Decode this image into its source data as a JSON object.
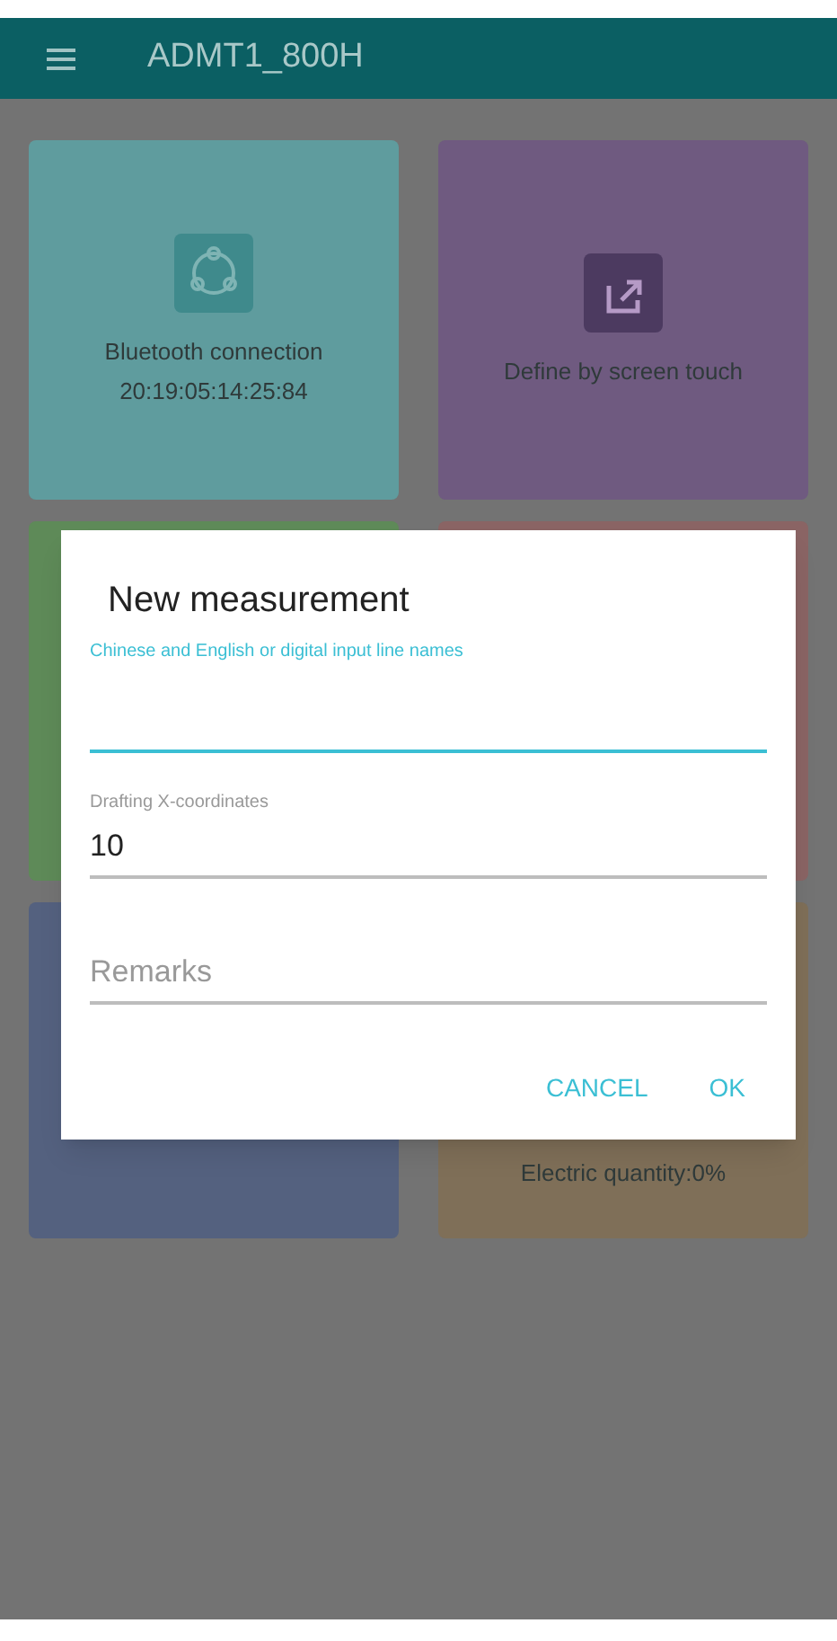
{
  "app_bar": {
    "title": "ADMT1_800H"
  },
  "cards": [
    {
      "kind": "bluetooth",
      "color": "#5f9c9e",
      "lines": [
        "Bluetooth connection",
        "20:19:05:14:25:84"
      ]
    },
    {
      "kind": "touch",
      "color": "#6f5a80",
      "lines": [
        "Define by screen touch"
      ]
    },
    {
      "kind": "plain",
      "color": "#5e8a58"
    },
    {
      "kind": "plain",
      "color": "#8a6464"
    },
    {
      "kind": "plain",
      "color": "#54617f"
    },
    {
      "kind": "plain",
      "color": "#7f6f58",
      "lines": [
        "Electric quantity:0%"
      ]
    }
  ],
  "dialog": {
    "title": "New measurement",
    "fields": [
      {
        "label": "Chinese and English or digital input line names",
        "focused": true
      },
      {
        "label": "Drafting X-coordinates",
        "value": "10",
        "focused": false
      },
      {
        "placeholder": "Remarks",
        "focused": false
      }
    ],
    "buttons": [
      "CANCEL",
      "OK"
    ]
  }
}
